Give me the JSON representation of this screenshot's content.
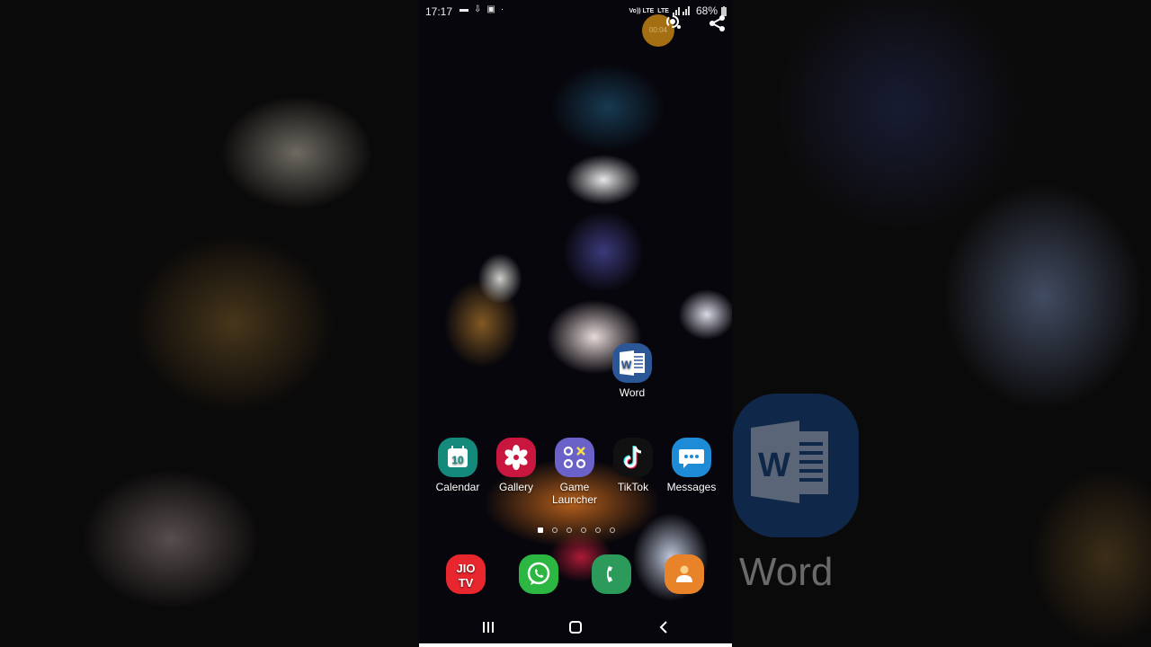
{
  "status_bar": {
    "time": "17:17",
    "carrier_label_1": "Vo)) LTE",
    "carrier_label_2": "LTE",
    "battery": "68%",
    "recording_timer": "00:04"
  },
  "home_screen": {
    "widget_app": {
      "label": "Word",
      "icon": "word-icon",
      "color": "#2b5797"
    },
    "apps_row": [
      {
        "label": "Calendar",
        "icon": "calendar-icon",
        "badge_text": "10",
        "color": "#138a7c"
      },
      {
        "label": "Gallery",
        "icon": "gallery-flower-icon",
        "color": "#c8163f"
      },
      {
        "label": "Game Launcher",
        "icon": "game-launcher-icon",
        "color": "#6a62c8"
      },
      {
        "label": "TikTok",
        "icon": "tiktok-icon",
        "color": "#111111"
      },
      {
        "label": "Messages",
        "icon": "messages-icon",
        "color": "#1e8bd6"
      }
    ],
    "page_indicator": {
      "pages": 6,
      "current": 0
    },
    "dock": [
      {
        "label": "JioTV",
        "icon": "jiotv-icon",
        "text_line1": "JIO",
        "text_line2": "TV",
        "color": "#e8262e"
      },
      {
        "label": "WhatsApp",
        "icon": "whatsapp-icon",
        "color": "#2bb741"
      },
      {
        "label": "Phone",
        "icon": "phone-icon",
        "color": "#2c9a5a"
      },
      {
        "label": "Contacts",
        "icon": "contacts-icon",
        "color": "#e8832a"
      }
    ]
  },
  "background_zoom": {
    "label": "Word"
  }
}
